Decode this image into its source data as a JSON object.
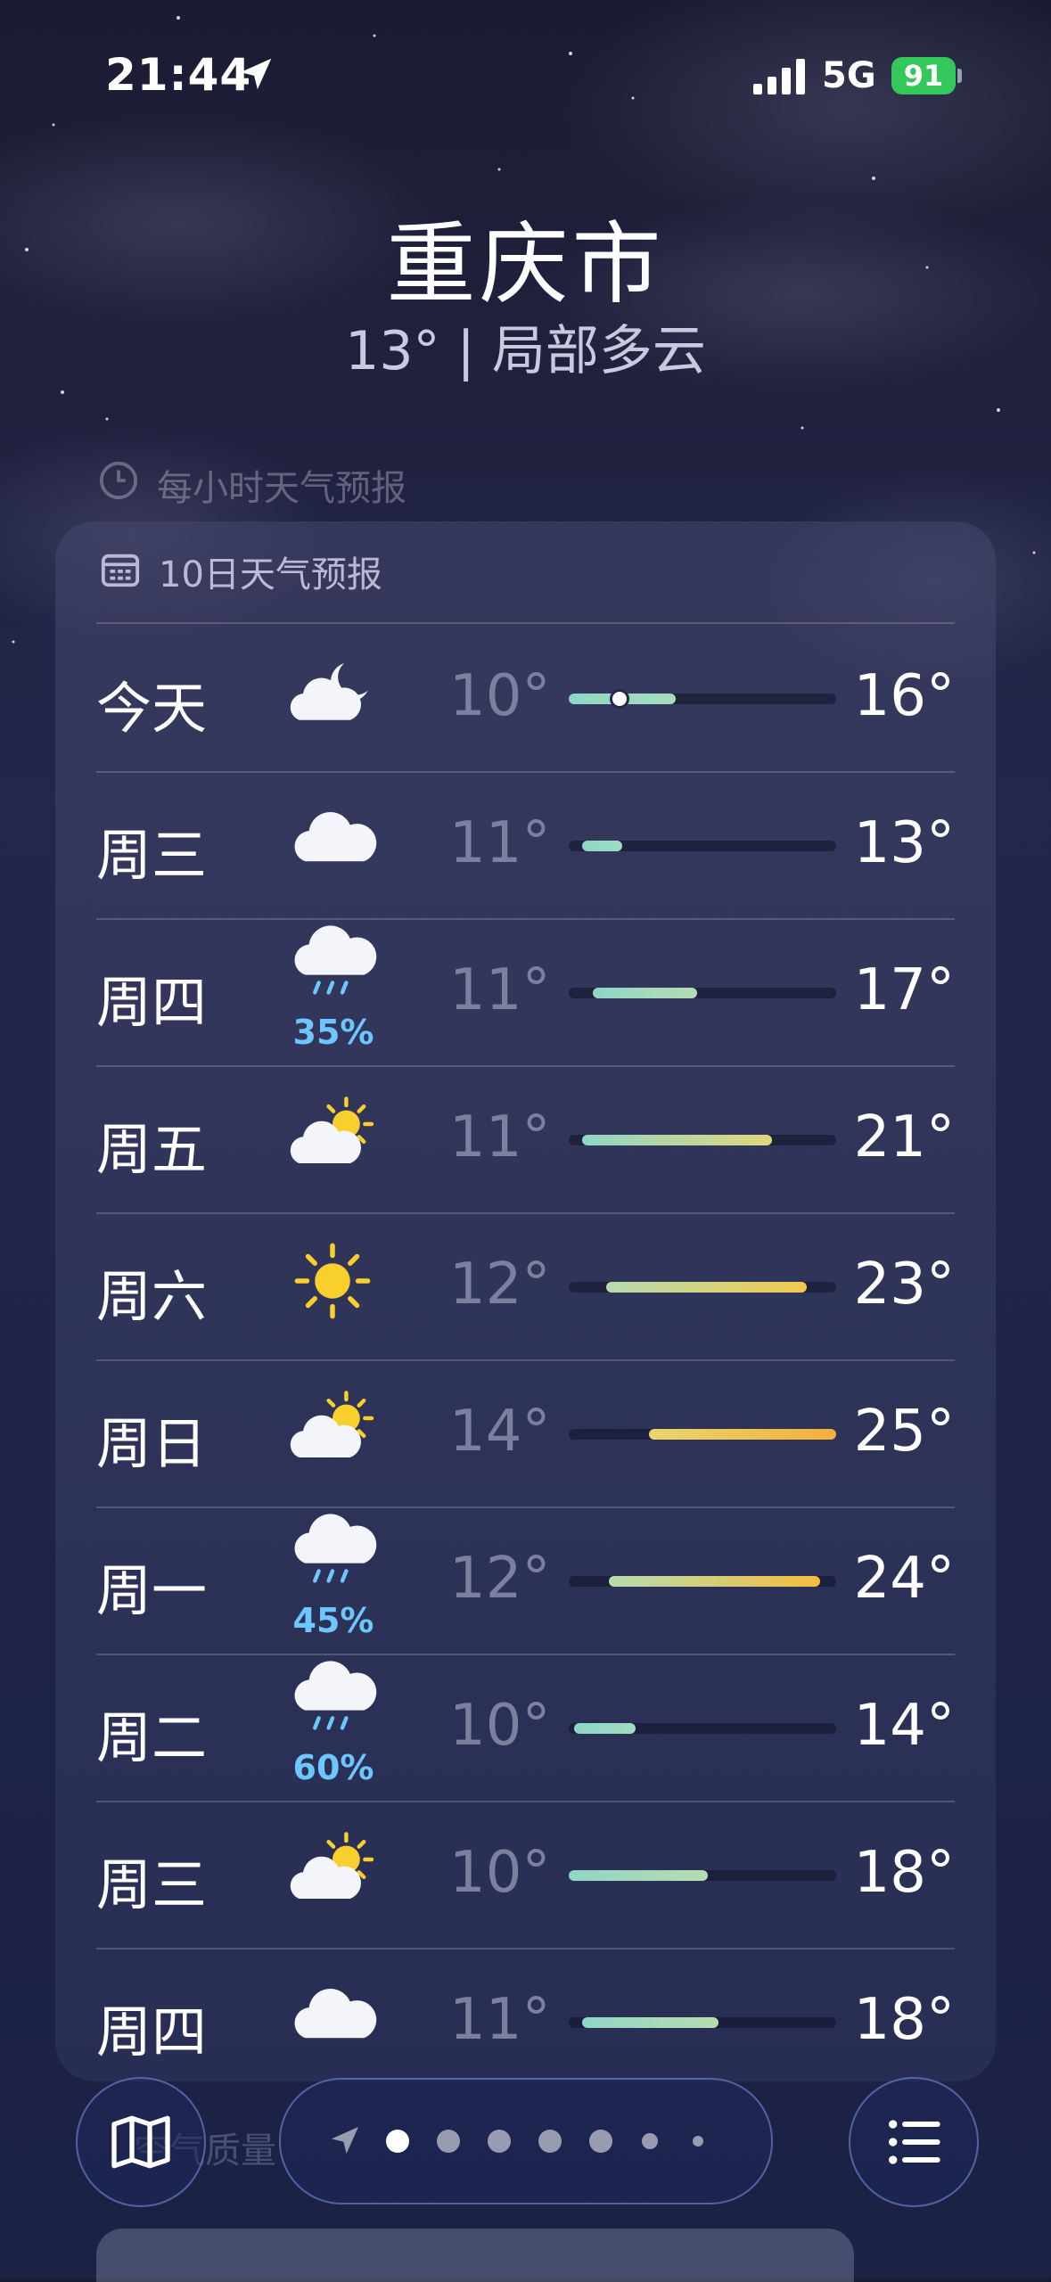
{
  "status": {
    "time": "21:44",
    "network": "5G",
    "battery": "91"
  },
  "location": {
    "city": "重庆市",
    "summary": "13° | 局部多云"
  },
  "hourly_header": "每小时天气预报",
  "forecast": {
    "header": "10日天气预报",
    "days": [
      {
        "day": "今天",
        "icon": "moon-cloud",
        "pct": "",
        "low": "10°",
        "high": "16°",
        "fill_start": 0.0,
        "fill_end": 0.4,
        "current": 0.18,
        "colors": [
          "#8fd6c6",
          "#a7dcc0"
        ]
      },
      {
        "day": "周三",
        "icon": "cloud",
        "pct": "",
        "low": "11°",
        "high": "13°",
        "fill_start": 0.05,
        "fill_end": 0.2,
        "colors": [
          "#8fd6c6",
          "#9edcc3"
        ]
      },
      {
        "day": "周四",
        "icon": "rain",
        "pct": "35%",
        "low": "11°",
        "high": "17°",
        "fill_start": 0.09,
        "fill_end": 0.48,
        "colors": [
          "#8fd6c6",
          "#b5dcb5"
        ]
      },
      {
        "day": "周五",
        "icon": "partly-sunny",
        "pct": "",
        "low": "11°",
        "high": "21°",
        "fill_start": 0.05,
        "fill_end": 0.76,
        "colors": [
          "#8fd6c6",
          "#e3d67a"
        ]
      },
      {
        "day": "周六",
        "icon": "sun",
        "pct": "",
        "low": "12°",
        "high": "23°",
        "fill_start": 0.14,
        "fill_end": 0.89,
        "colors": [
          "#b7dcb0",
          "#f2c94c"
        ]
      },
      {
        "day": "周日",
        "icon": "partly-sunny",
        "pct": "",
        "low": "14°",
        "high": "25°",
        "fill_start": 0.3,
        "fill_end": 1.0,
        "colors": [
          "#e9d66f",
          "#f4b03a"
        ]
      },
      {
        "day": "周一",
        "icon": "rain",
        "pct": "45%",
        "low": "12°",
        "high": "24°",
        "fill_start": 0.15,
        "fill_end": 0.94,
        "colors": [
          "#b7dcb0",
          "#f4be3e"
        ]
      },
      {
        "day": "周二",
        "icon": "rain",
        "pct": "60%",
        "low": "10°",
        "high": "14°",
        "fill_start": 0.02,
        "fill_end": 0.25,
        "colors": [
          "#8fd6c6",
          "#9edcc3"
        ]
      },
      {
        "day": "周三",
        "icon": "partly-sunny",
        "pct": "",
        "low": "10°",
        "high": "18°",
        "fill_start": 0.0,
        "fill_end": 0.52,
        "colors": [
          "#8fd6c6",
          "#b7dcb0"
        ]
      },
      {
        "day": "周四",
        "icon": "cloud",
        "pct": "",
        "low": "11°",
        "high": "18°",
        "fill_start": 0.05,
        "fill_end": 0.56,
        "colors": [
          "#8fd6c6",
          "#b7dcb0"
        ]
      }
    ]
  },
  "aqi_label": "空气质量"
}
